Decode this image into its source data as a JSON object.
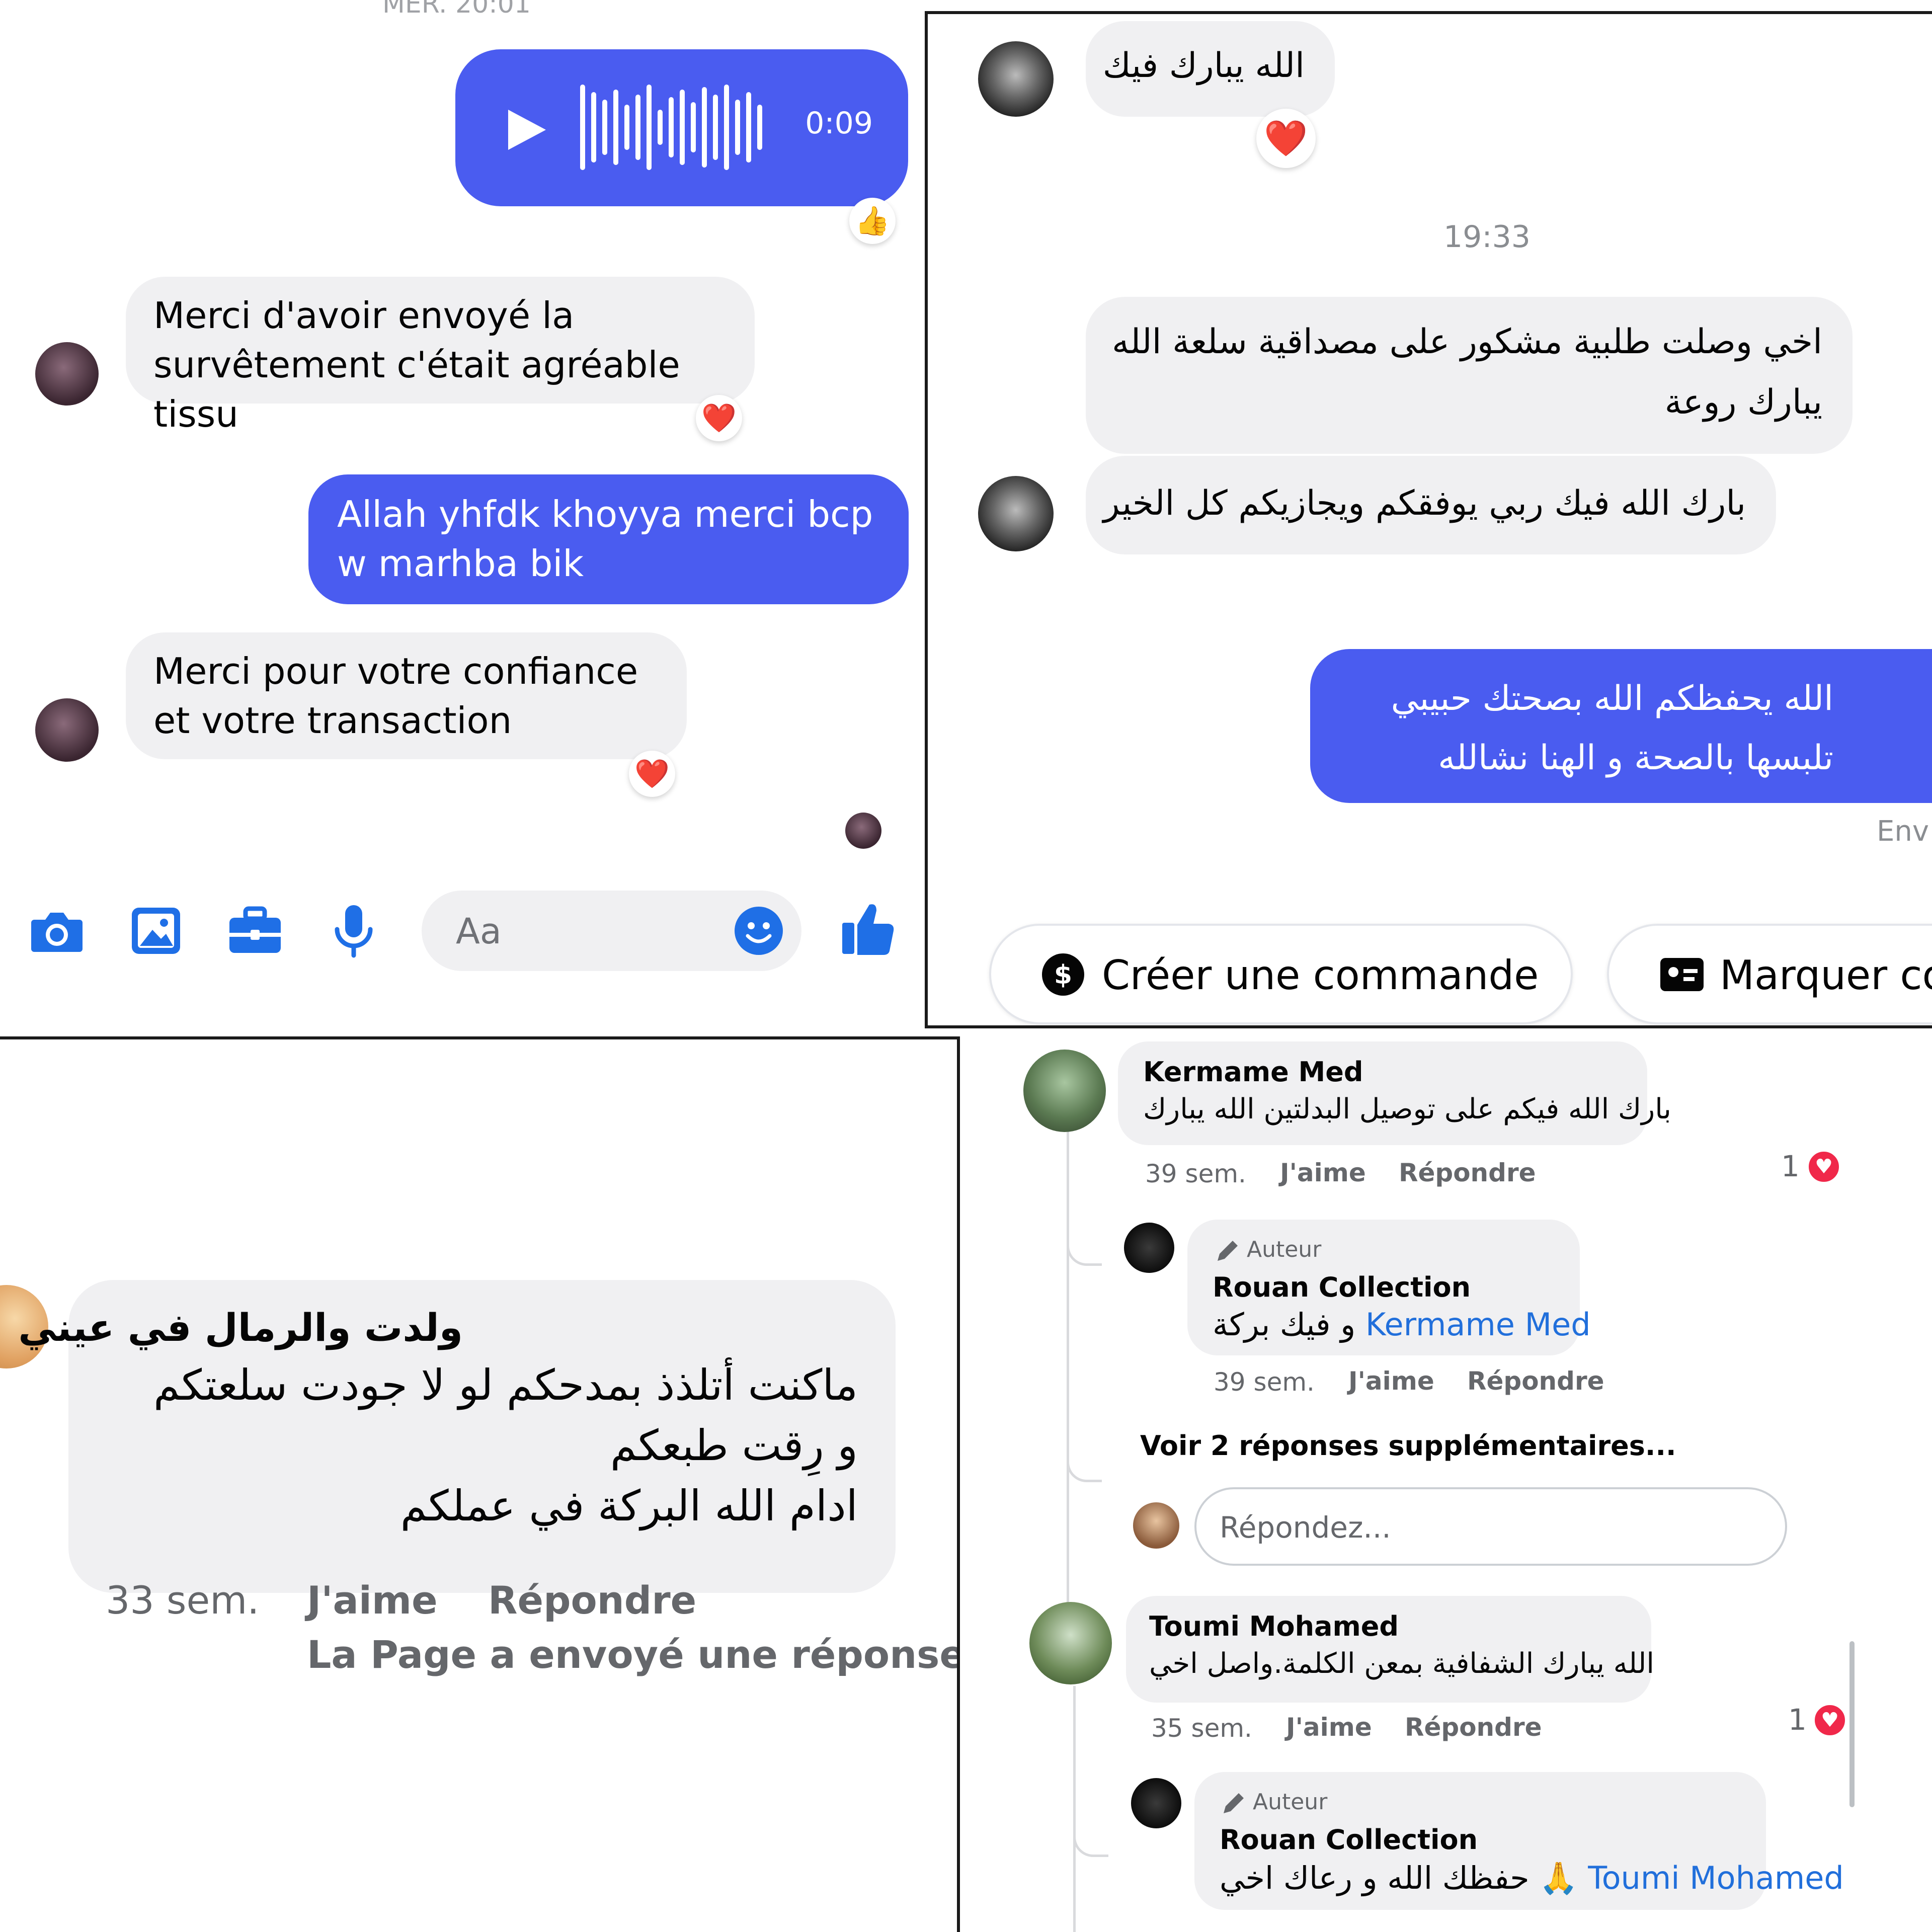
{
  "top_left": {
    "time_header": "MER. 20:01",
    "voice_message": {
      "duration": "0:09",
      "reaction": "thumbs-up"
    },
    "messages": [
      {
        "text": "Merci d'avoir envoyé la survêtement c'était agréable tissu",
        "reaction": "heart"
      },
      {
        "text": "Allah yhfdk khoyya merci bcp w marhba bik"
      },
      {
        "text": "Merci pour votre confiance et votre transaction",
        "reaction": "heart"
      }
    ],
    "composer": {
      "placeholder": "Aa",
      "icons": [
        "camera-icon",
        "image-icon",
        "briefcase-icon",
        "microphone-icon",
        "emoji-icon",
        "thumbs-up-icon"
      ]
    }
  },
  "top_right": {
    "messages": [
      {
        "text": "الله يبارك فيك",
        "reaction": "heart"
      },
      {
        "text": "اخي وصلت طلبية مشكور على مصداقية سلعة الله يبارك روعة"
      },
      {
        "text": "بارك الله فيك ربي يوفقكم ويجازيكم كل الخير"
      },
      {
        "text": "الله يحفظكم الله بصحتك حبيبي تلبسها بالصحة و الهنا نشالله"
      }
    ],
    "time_divider": "19:33",
    "status": "Env",
    "buttons": [
      "Créer une commande",
      "Marquer co"
    ]
  },
  "bottom_left": {
    "comment": {
      "title": "ولدت والرمال في عيني",
      "lines": [
        "ماكنت أتلذذ بمدحكم لو لا جودت سلعتكم",
        "و رِقت طبعكم",
        "ادام الله البركة في عملكم"
      ],
      "age": "33 sem.",
      "like": "J'aime",
      "reply": "Répondre",
      "page_reply_note": "La Page a envoyé une réponse p"
    }
  },
  "bottom_right": {
    "comments": [
      {
        "name": "Kermame Med",
        "text": "بارك الله فيكم على توصيل البدلتين الله يبارك",
        "age": "39 sem.",
        "like": "J'aime",
        "reply": "Répondre",
        "likes": "1",
        "reply_thread": {
          "badge": "Auteur",
          "name": "Rouan Collection",
          "text": "و فيك بركة",
          "mention": "Kermame Med",
          "age": "39 sem.",
          "like": "J'aime",
          "reply": "Répondre"
        },
        "more_replies": "Voir 2 réponses supplémentaires...",
        "reply_placeholder": "Répondez..."
      },
      {
        "name": "Toumi Mohamed",
        "text": "الله يبارك الشفافية بمعن الكلمة.واصل اخي",
        "age": "35 sem.",
        "like": "J'aime",
        "reply": "Répondre",
        "likes": "1",
        "reply_thread": {
          "badge": "Auteur",
          "name": "Rouan Collection",
          "text": "حفظك الله و رعاك اخي 🙏",
          "mention": "Toumi Mohamed"
        }
      }
    ]
  },
  "colors": {
    "messenger_blue": "#4a5cf0",
    "grey_bubble": "#f0f0f2",
    "link_blue": "#216fdb",
    "heart_red": "#f0284a"
  }
}
